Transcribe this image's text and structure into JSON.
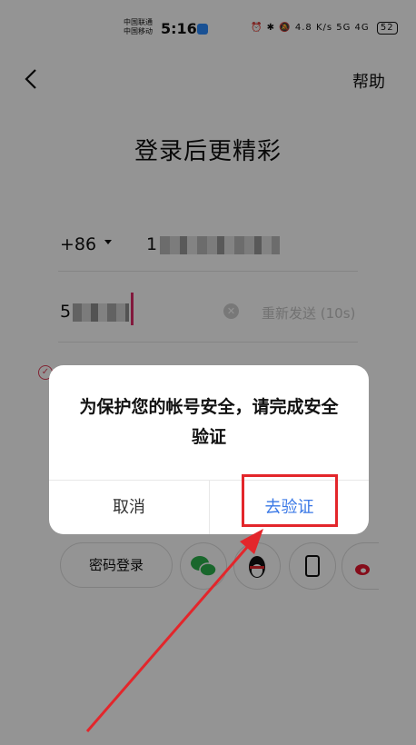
{
  "status_bar": {
    "carrier1": "中国联通",
    "carrier2": "中国移动",
    "time": "5:16",
    "net_speed": "4.8 K/s",
    "signal": "5G 4G",
    "battery": "52"
  },
  "header": {
    "help": "帮助"
  },
  "title": "登录后更精彩",
  "phone": {
    "country_code": "+86",
    "number_visible": "1"
  },
  "code": {
    "value_visible": "5",
    "resend": "重新发送 (10s)"
  },
  "dialog": {
    "message": "为保护您的帐号安全，请完成安全验证",
    "cancel": "取消",
    "verify": "去验证"
  },
  "social": {
    "password_login": "密码登录"
  },
  "colors": {
    "accent_blue": "#3a78e6",
    "highlight_red": "#e3262b",
    "cursor": "#e02b6a"
  }
}
